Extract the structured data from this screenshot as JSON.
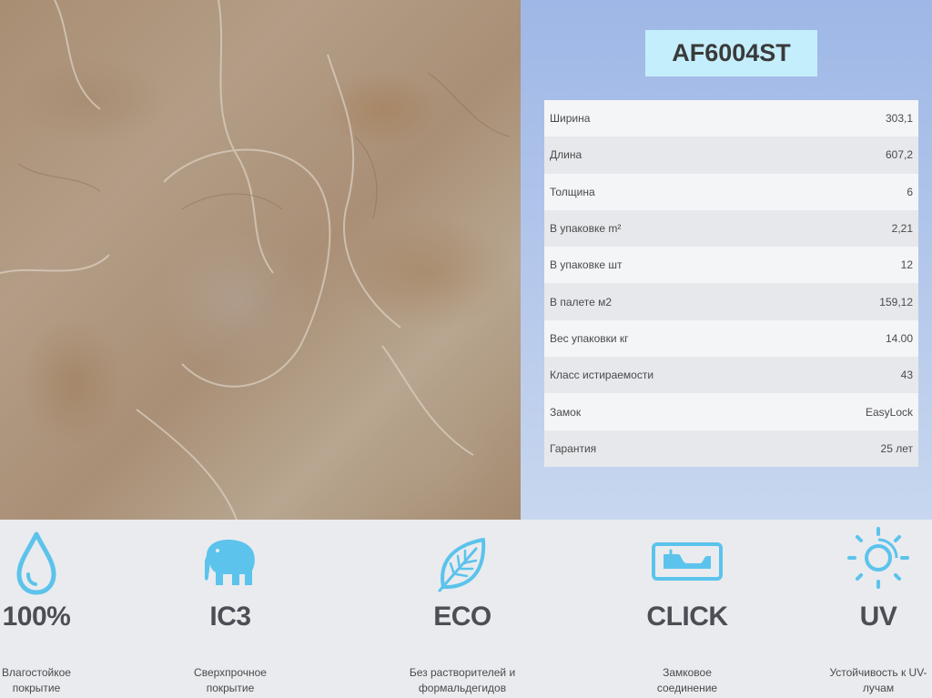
{
  "product_code": "AF6004ST",
  "specs": [
    {
      "label": "Ширина",
      "value": "303,1"
    },
    {
      "label": "Длина",
      "value": "607,2"
    },
    {
      "label": "Толщина",
      "value": "6"
    },
    {
      "label": "В упаковке m²",
      "value": "2,21"
    },
    {
      "label": "В упаковке шт",
      "value": "12"
    },
    {
      "label": "В палете м2",
      "value": "159,12"
    },
    {
      "label": "Вес упаковки кг",
      "value": "14.00"
    },
    {
      "label": "Класс истираемости",
      "value": "43"
    },
    {
      "label": "Замок",
      "value": "EasyLock"
    },
    {
      "label": "Гарантия",
      "value": "25 лет"
    }
  ],
  "features": [
    {
      "icon": "water-drop-icon",
      "title": "100%",
      "line1": "Влагостойкое",
      "line2": "покрытие"
    },
    {
      "icon": "elephant-icon",
      "title": "IC3",
      "line1": "Сверхпрочное",
      "line2": "покрытие"
    },
    {
      "icon": "leaf-icon",
      "title": "ECO",
      "line1": "Без растворителей и",
      "line2": "формальдегидов"
    },
    {
      "icon": "click-lock-icon",
      "title": "CLICK",
      "line1": "Замковое",
      "line2": "соединение"
    },
    {
      "icon": "sun-icon",
      "title": "UV",
      "line1": "Устойчивость к UV-",
      "line2": "лучам"
    }
  ],
  "colors": {
    "panel_top": "#9eb7e6",
    "code_box": "#c4eefc",
    "icon_blue": "#5bc3ec",
    "title_text": "#4b4e55"
  }
}
